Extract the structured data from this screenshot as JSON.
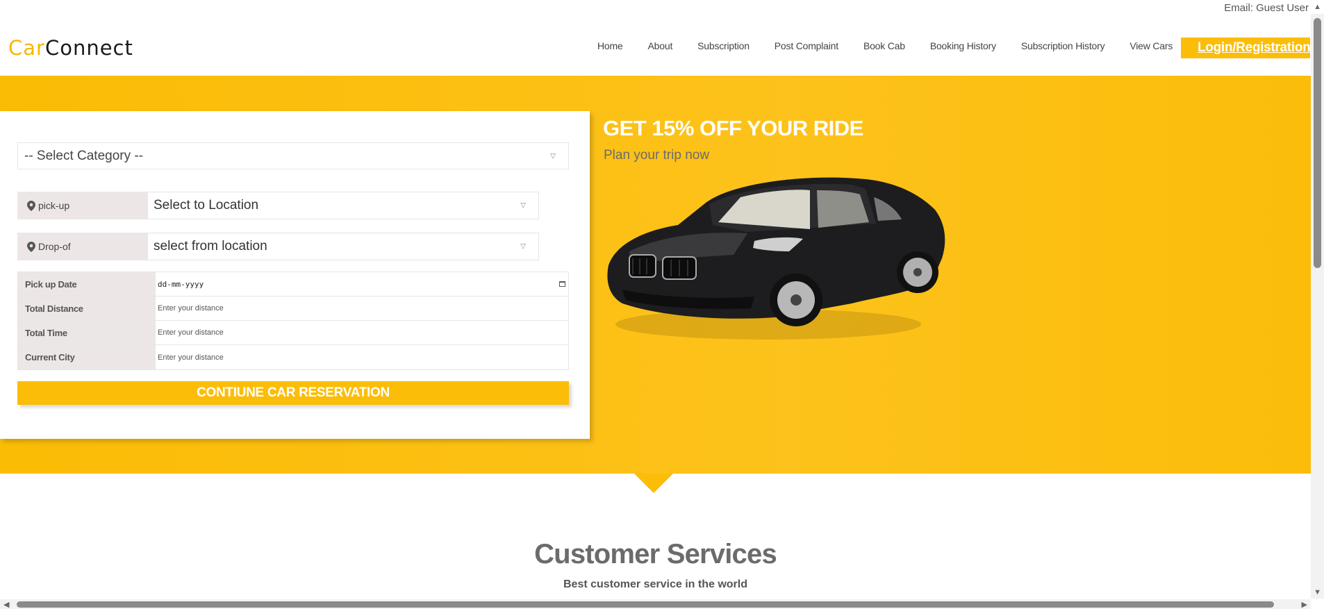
{
  "header": {
    "email_label": "Email: Guest User",
    "logo_part1": "Car",
    "logo_part2": "Connect",
    "nav": [
      {
        "label": "Home"
      },
      {
        "label": "About"
      },
      {
        "label": "Subscription"
      },
      {
        "label": "Post Complaint"
      },
      {
        "label": "Book Cab"
      },
      {
        "label": "Booking History"
      },
      {
        "label": "Subscription History"
      },
      {
        "label": "View Cars"
      }
    ],
    "login_label": "Login/Registration"
  },
  "form": {
    "category_placeholder": "-- Select Category --",
    "pickup": {
      "label": "pick-up",
      "value": "Select to Location"
    },
    "dropoff": {
      "label": "Drop-of",
      "value": "select from location"
    },
    "fields": [
      {
        "label": "Pick up Date",
        "placeholder": "dd-mm-yyyy"
      },
      {
        "label": "Total Distance",
        "placeholder": "Enter your distance"
      },
      {
        "label": "Total Time",
        "placeholder": "Enter your distance"
      },
      {
        "label": "Current City",
        "placeholder": "Enter your distance"
      }
    ],
    "submit_label": "CONTIUNE CAR RESERVATION"
  },
  "promo": {
    "title": "GET 15% OFF YOUR RIDE",
    "subtitle": "Plan your trip now"
  },
  "services": {
    "title": "Customer Services",
    "subtitle": "Best customer service in the world"
  },
  "colors": {
    "accent": "#fbbd08",
    "logo_dark": "#1a1a1a",
    "label_bg": "#ede6e6"
  },
  "icons": [
    "map-pin-icon",
    "calendar-icon",
    "chevron-down-icon",
    "scroll-arrow-icon"
  ]
}
